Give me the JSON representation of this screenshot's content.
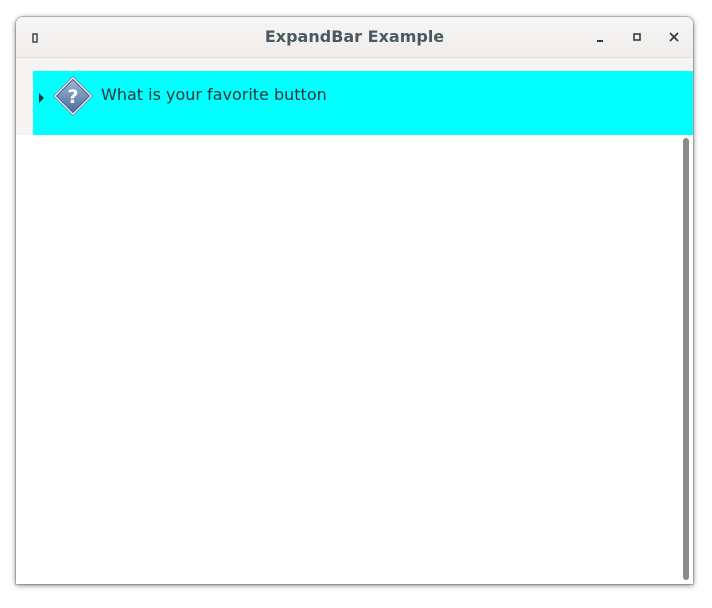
{
  "window": {
    "title": "ExpandBar Example"
  },
  "titlebar": {
    "menu_icon": "window-menu-icon",
    "minimize_icon": "minimize-icon",
    "maximize_icon": "maximize-icon",
    "close_icon": "close-icon"
  },
  "expandbar": {
    "items": [
      {
        "label": "What is your favorite button",
        "icon": "question-icon",
        "expanded": false,
        "header_color": "#00ffff"
      }
    ]
  },
  "colors": {
    "header_background": "#00ffff",
    "title_text": "#4a5a61",
    "scroll_thumb": "#8a8a8a"
  }
}
